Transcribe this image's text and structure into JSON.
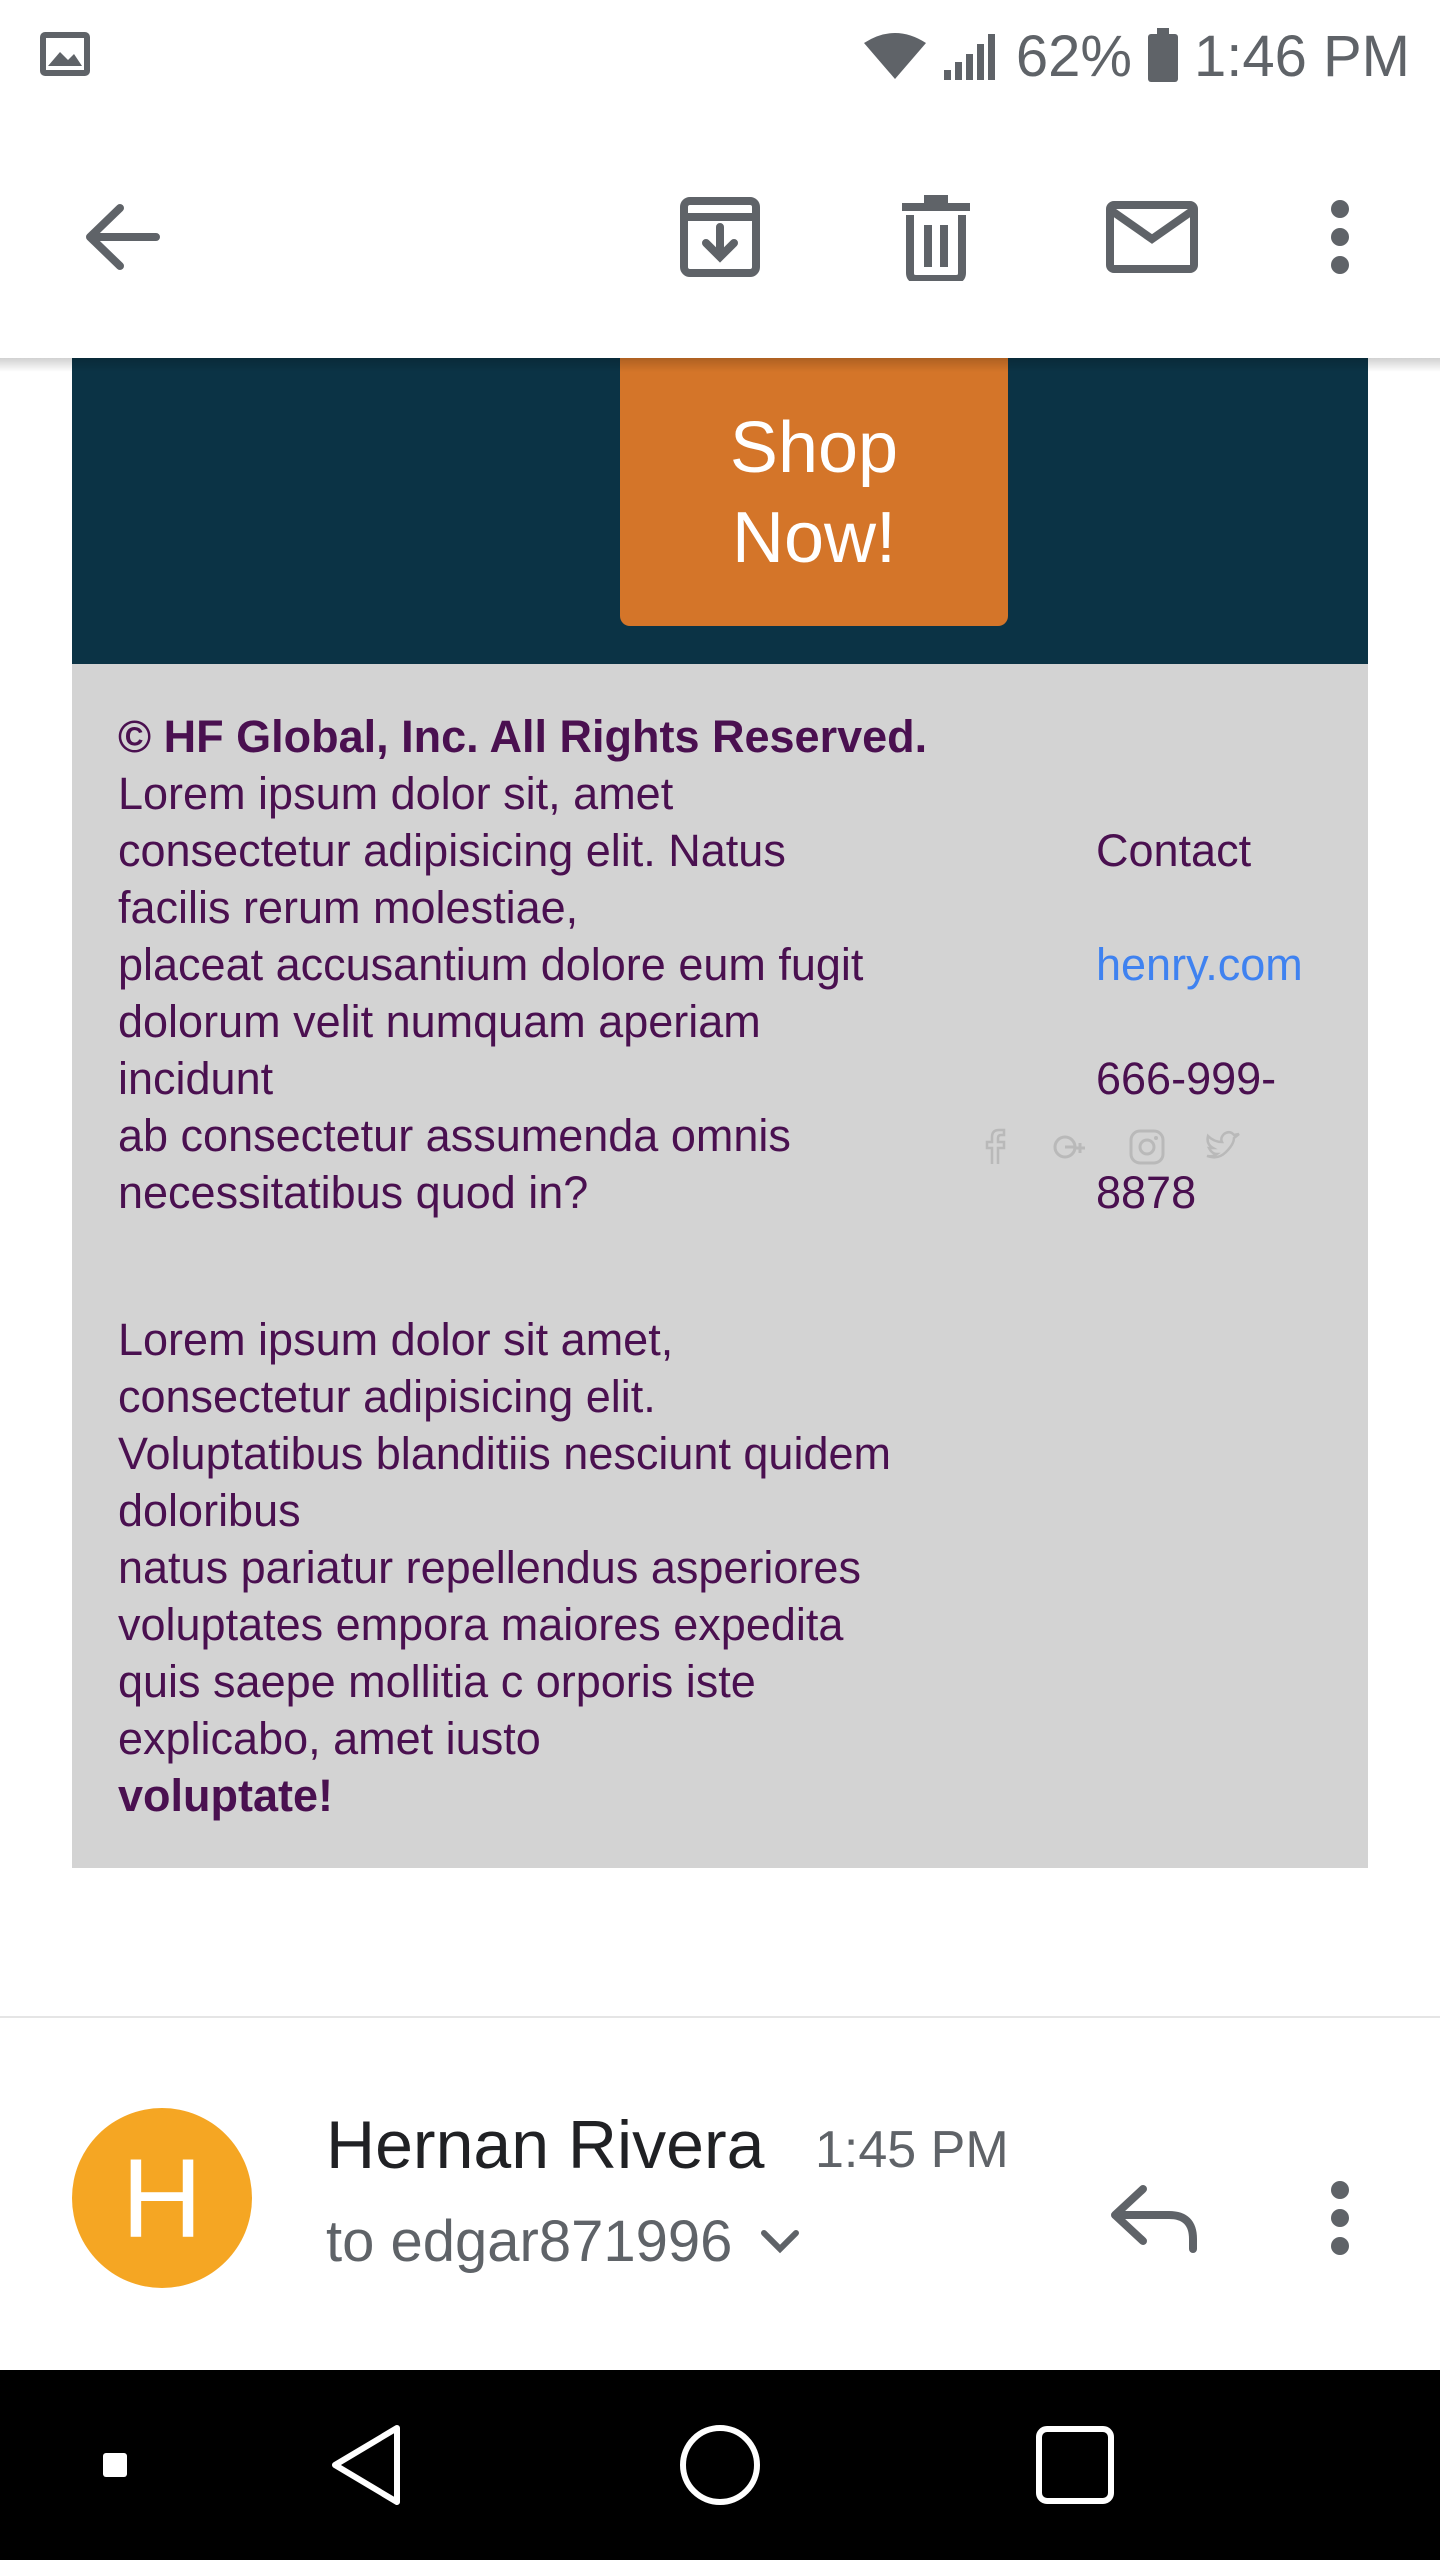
{
  "status_bar": {
    "battery": "62%",
    "time": "1:46 PM",
    "icons": [
      "image-icon",
      "wifi-icon",
      "signal-icon",
      "battery-icon"
    ]
  },
  "toolbar": {
    "icons": [
      "back-arrow-icon",
      "archive-icon",
      "delete-icon",
      "mail-icon",
      "more-vert-icon"
    ]
  },
  "email": {
    "shop_button": [
      "Shop",
      "Now!"
    ],
    "footer": {
      "copyright": "© HF Global, Inc. All Rights Reserved.",
      "para1": [
        "Lorem ipsum dolor sit, amet",
        "consectetur adipisicing elit. Natus",
        "facilis rerum molestiae,",
        "placeat accusantium dolore eum fugit",
        "dolorum velit numquam aperiam",
        "incidunt",
        "ab consectetur assumenda omnis",
        "necessitatibus quod in?"
      ],
      "para2": [
        "Lorem ipsum dolor sit amet,",
        "consectetur adipisicing elit.",
        "Voluptatibus blanditiis nesciunt quidem",
        "doloribus",
        "natus pariatur repellendus asperiores",
        "voluptates empora maiores expedita",
        "quis saepe mollitia c orporis iste",
        "explicabo, amet iusto"
      ],
      "para2_bold": "voluptate!",
      "contact_label": "Contact",
      "website": "henry.com",
      "phone": "666-999-8878",
      "social_icons": [
        "facebook-icon",
        "google-plus-icon",
        "instagram-icon",
        "twitter-icon"
      ]
    },
    "colors": {
      "banner": "#0b3345",
      "shop_button": "#d47529",
      "footer_bg": "#d3d3d3",
      "footer_text": "#4a1050",
      "link": "#3f82f0",
      "avatar": "#f5a623"
    }
  },
  "sender": {
    "avatar_letter": "H",
    "name": "Hernan Rivera",
    "time": "1:45 PM",
    "recipient": "to edgar871996"
  },
  "nav": {
    "icons": [
      "recent-apps-small-icon",
      "back-triangle-icon",
      "home-circle-icon",
      "overview-square-icon"
    ]
  }
}
